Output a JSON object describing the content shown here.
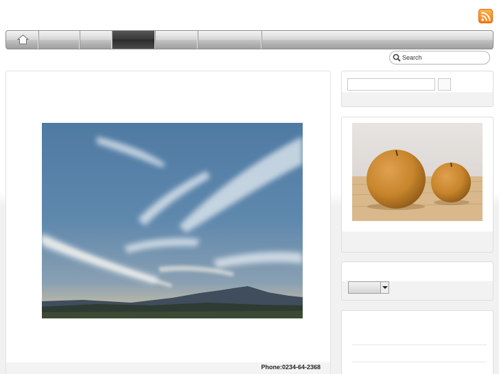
{
  "header": {
    "rss_icon": "rss-icon",
    "accent": "#f5871f"
  },
  "nav": {
    "home_icon": "home-icon",
    "items": [
      "",
      "",
      "",
      "",
      ""
    ],
    "active_index": 2
  },
  "search": {
    "placeholder": "Search",
    "icon": "search-icon"
  },
  "main": {
    "image": "sky-over-mountain-photo",
    "footer": {
      "phone": "Phone:0234-64-2368"
    }
  },
  "sidebar": {
    "search_widget": {
      "value": "",
      "button_label": ""
    },
    "featured_image": "two-pears-photo",
    "select_widget": {
      "selected": ""
    },
    "list_widget": {
      "items": [
        "",
        ""
      ]
    }
  }
}
